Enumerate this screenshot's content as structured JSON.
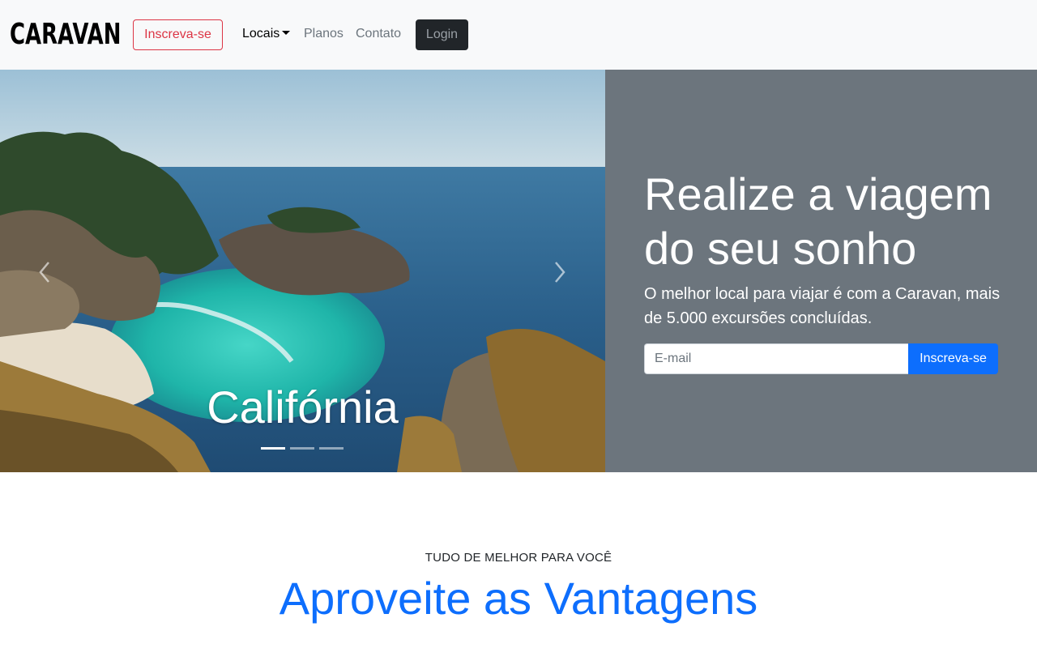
{
  "navbar": {
    "brand": "CARAVAN",
    "signup_label": "Inscreva-se",
    "links": [
      {
        "label": "Locais",
        "dropdown": true,
        "active": true
      },
      {
        "label": "Planos"
      },
      {
        "label": "Contato"
      }
    ],
    "login_label": "Login"
  },
  "carousel": {
    "caption": "Califórnia",
    "indicators_count": 3,
    "active_index": 0
  },
  "hero": {
    "title": "Realize a viagem do seu sonho",
    "lead": "O melhor local para viajar é com a Caravan, mais de 5.000 excursões concluídas.",
    "email_placeholder": "E-mail",
    "subscribe_label": "Inscreva-se"
  },
  "section": {
    "eyebrow": "TUDO DE MELHOR PARA VOCÊ",
    "title": "Aproveite as Vantagens"
  },
  "colors": {
    "primary": "#0d6efd",
    "danger": "#dc3545",
    "secondary": "#6c757d",
    "dark": "#212529",
    "light": "#f8f9fa"
  }
}
